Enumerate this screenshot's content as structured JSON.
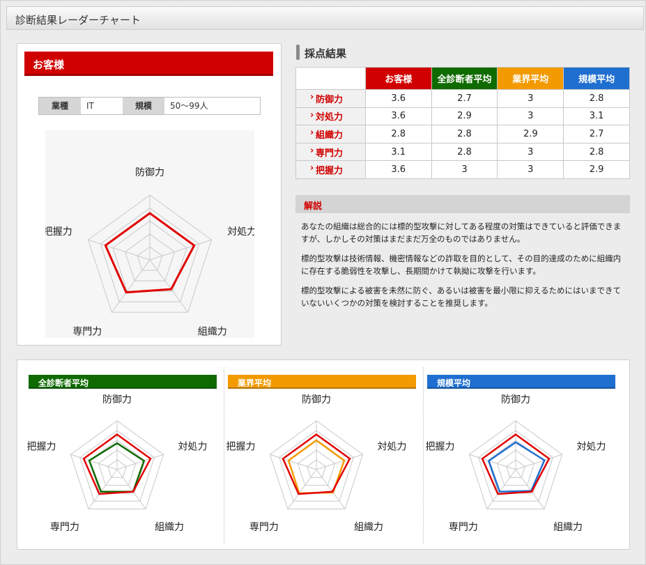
{
  "page": {
    "title": "診断結果レーダーチャート"
  },
  "customer": {
    "header": "お客様",
    "industry_label": "業種",
    "industry_value": "IT",
    "scale_label": "規模",
    "scale_value": "50〜99人"
  },
  "score": {
    "heading": "採点結果",
    "columns": [
      "お客様",
      "全診断者平均",
      "業界平均",
      "規模平均"
    ],
    "column_colors": [
      "#d10000",
      "#0f6b00",
      "#f29a00",
      "#1f6fd1"
    ],
    "rows": [
      {
        "label": "防御力",
        "values": [
          "3.6",
          "2.7",
          "3",
          "2.8"
        ]
      },
      {
        "label": "対処力",
        "values": [
          "3.6",
          "2.9",
          "3",
          "3.1"
        ]
      },
      {
        "label": "組織力",
        "values": [
          "2.8",
          "2.8",
          "2.9",
          "2.7"
        ]
      },
      {
        "label": "専門力",
        "values": [
          "3.1",
          "2.8",
          "3",
          "2.8"
        ]
      },
      {
        "label": "把握力",
        "values": [
          "3.6",
          "3",
          "3",
          "2.9"
        ]
      }
    ]
  },
  "explanation": {
    "heading": "解説",
    "paragraphs": [
      "あなたの組織は総合的には標的型攻撃に対してある程度の対策はできていると評価できますが、しかしその対策はまだまだ万全のものではありません。",
      "標的型攻撃は技術情報、機密情報などの詐取を目的として、その目的達成のために組織内に存在する脆弱性を攻撃し、長期間かけて執拗に攻撃を行います。",
      "標的型攻撃による被害を未然に防ぐ、あるいは被害を最小限に抑えるためにはいまできていないいくつかの対策を検討することを推奨します。"
    ]
  },
  "comparisons": [
    {
      "title": "全診断者平均",
      "color": "#0f6b00"
    },
    {
      "title": "業界平均",
      "color": "#f29a00"
    },
    {
      "title": "規模平均",
      "color": "#1f6fd1"
    }
  ],
  "chart_data": [
    {
      "type": "radar",
      "title": "お客様",
      "axes": [
        "防御力",
        "対処力",
        "組織力",
        "専門力",
        "把握力"
      ],
      "range": [
        0,
        5
      ],
      "series": [
        {
          "name": "お客様",
          "color": "#e10000",
          "values": [
            3.6,
            3.6,
            2.8,
            3.1,
            3.6
          ]
        }
      ]
    },
    {
      "type": "radar",
      "title": "全診断者平均",
      "axes": [
        "防御力",
        "対処力",
        "組織力",
        "専門力",
        "把握力"
      ],
      "range": [
        0,
        5
      ],
      "series": [
        {
          "name": "お客様",
          "color": "#e10000",
          "values": [
            3.6,
            3.6,
            2.8,
            3.1,
            3.6
          ]
        },
        {
          "name": "全診断者平均",
          "color": "#0f6b00",
          "values": [
            2.7,
            2.9,
            2.8,
            2.8,
            3
          ]
        }
      ]
    },
    {
      "type": "radar",
      "title": "業界平均",
      "axes": [
        "防御力",
        "対処力",
        "組織力",
        "専門力",
        "把握力"
      ],
      "range": [
        0,
        5
      ],
      "series": [
        {
          "name": "お客様",
          "color": "#e10000",
          "values": [
            3.6,
            3.6,
            2.8,
            3.1,
            3.6
          ]
        },
        {
          "name": "業界平均",
          "color": "#f29a00",
          "values": [
            3,
            3,
            2.9,
            3,
            3
          ]
        }
      ]
    },
    {
      "type": "radar",
      "title": "規模平均",
      "axes": [
        "防御力",
        "対処力",
        "組織力",
        "専門力",
        "把握力"
      ],
      "range": [
        0,
        5
      ],
      "series": [
        {
          "name": "お客様",
          "color": "#e10000",
          "values": [
            3.6,
            3.6,
            2.8,
            3.1,
            3.6
          ]
        },
        {
          "name": "規模平均",
          "color": "#1f6fd1",
          "values": [
            2.8,
            3.1,
            2.7,
            2.8,
            2.9
          ]
        }
      ]
    }
  ]
}
